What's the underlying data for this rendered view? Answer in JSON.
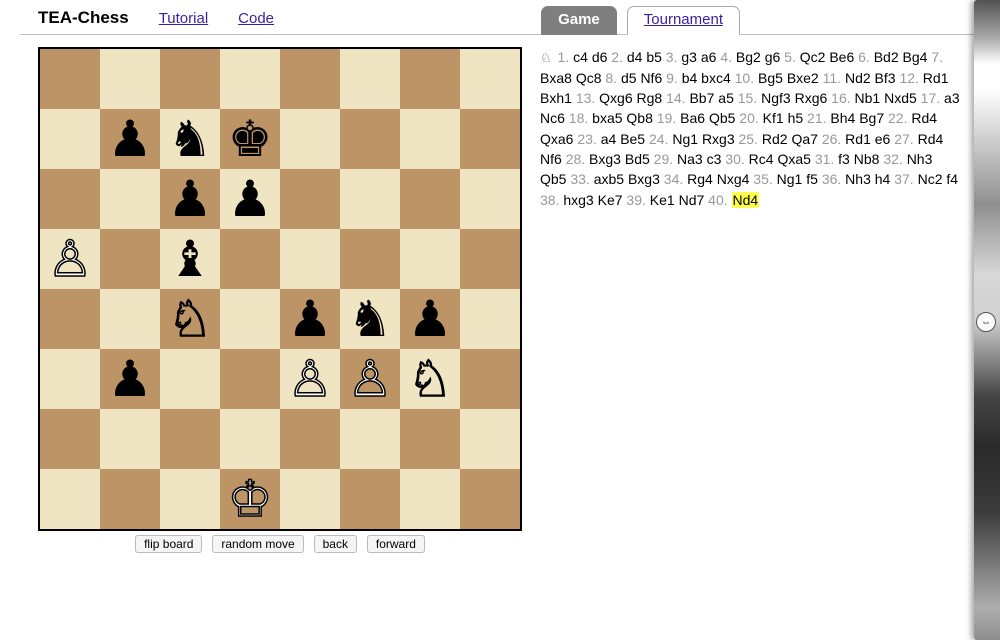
{
  "header": {
    "brand": "TEA-Chess",
    "links": [
      "Tutorial",
      "Code"
    ],
    "tabs": [
      {
        "label": "Game",
        "active": true
      },
      {
        "label": "Tournament",
        "active": false
      }
    ]
  },
  "colors": {
    "light_square": "#efe5c3",
    "dark_square": "#bc9465",
    "highlight_move": "#ffff4d"
  },
  "controls": {
    "flip": "flip board",
    "random": "random move",
    "back": "back",
    "forward": "forward"
  },
  "board": {
    "light_on_a1": true,
    "pieces": [
      {
        "square": "b7",
        "glyph": "♟",
        "color": "black",
        "name": "black-pawn"
      },
      {
        "square": "c7",
        "glyph": "♞",
        "color": "black",
        "name": "black-knight"
      },
      {
        "square": "d7",
        "glyph": "♚",
        "color": "black",
        "name": "black-king"
      },
      {
        "square": "c6",
        "glyph": "♟",
        "color": "black",
        "name": "black-pawn"
      },
      {
        "square": "d6",
        "glyph": "♟",
        "color": "black",
        "name": "black-pawn"
      },
      {
        "square": "a5",
        "glyph": "♙",
        "color": "white",
        "name": "white-pawn"
      },
      {
        "square": "c5",
        "glyph": "♝",
        "color": "black",
        "name": "black-bishop"
      },
      {
        "square": "c4",
        "glyph": "♘",
        "color": "white",
        "name": "white-knight"
      },
      {
        "square": "e4",
        "glyph": "♟",
        "color": "black",
        "name": "black-pawn"
      },
      {
        "square": "f4",
        "glyph": "♞",
        "color": "black",
        "name": "black-knight"
      },
      {
        "square": "g4",
        "glyph": "♟",
        "color": "black",
        "name": "black-pawn"
      },
      {
        "square": "b3",
        "glyph": "♟",
        "color": "black",
        "name": "black-pawn"
      },
      {
        "square": "e3",
        "glyph": "♙",
        "color": "white",
        "name": "white-pawn"
      },
      {
        "square": "f3",
        "glyph": "♙",
        "color": "white",
        "name": "white-pawn"
      },
      {
        "square": "g3",
        "glyph": "♘",
        "color": "white",
        "name": "white-knight"
      },
      {
        "square": "d1",
        "glyph": "♔",
        "color": "white",
        "name": "white-king"
      }
    ]
  },
  "moves": [
    {
      "n": 1,
      "w": "c4",
      "b": "d6"
    },
    {
      "n": 2,
      "w": "d4",
      "b": "b5"
    },
    {
      "n": 3,
      "w": "g3",
      "b": "a6"
    },
    {
      "n": 4,
      "w": "Bg2",
      "b": "g6"
    },
    {
      "n": 5,
      "w": "Qc2",
      "b": "Be6"
    },
    {
      "n": 6,
      "w": "Bd2",
      "b": "Bg4"
    },
    {
      "n": 7,
      "w": "Bxa8",
      "b": "Qc8"
    },
    {
      "n": 8,
      "w": "d5",
      "b": "Nf6"
    },
    {
      "n": 9,
      "w": "b4",
      "b": "bxc4"
    },
    {
      "n": 10,
      "w": "Bg5",
      "b": "Bxe2"
    },
    {
      "n": 11,
      "w": "Nd2",
      "b": "Bf3"
    },
    {
      "n": 12,
      "w": "Rd1",
      "b": "Bxh1"
    },
    {
      "n": 13,
      "w": "Qxg6",
      "b": "Rg8"
    },
    {
      "n": 14,
      "w": "Bb7",
      "b": "a5"
    },
    {
      "n": 15,
      "w": "Ngf3",
      "b": "Rxg6"
    },
    {
      "n": 16,
      "w": "Nb1",
      "b": "Nxd5"
    },
    {
      "n": 17,
      "w": "a3",
      "b": "Nc6"
    },
    {
      "n": 18,
      "w": "bxa5",
      "b": "Qb8"
    },
    {
      "n": 19,
      "w": "Ba6",
      "b": "Qb5"
    },
    {
      "n": 20,
      "w": "Kf1",
      "b": "h5"
    },
    {
      "n": 21,
      "w": "Bh4",
      "b": "Bg7"
    },
    {
      "n": 22,
      "w": "Rd4",
      "b": "Qxa6"
    },
    {
      "n": 23,
      "w": "a4",
      "b": "Be5"
    },
    {
      "n": 24,
      "w": "Ng1",
      "b": "Rxg3"
    },
    {
      "n": 25,
      "w": "Rd2",
      "b": "Qa7"
    },
    {
      "n": 26,
      "w": "Rd1",
      "b": "e6"
    },
    {
      "n": 27,
      "w": "Rd4",
      "b": "Nf6"
    },
    {
      "n": 28,
      "w": "Bxg3",
      "b": "Bd5"
    },
    {
      "n": 29,
      "w": "Na3",
      "b": "c3"
    },
    {
      "n": 30,
      "w": "Rc4",
      "b": "Qxa5"
    },
    {
      "n": 31,
      "w": "f3",
      "b": "Nb8"
    },
    {
      "n": 32,
      "w": "Nh3",
      "b": "Qb5"
    },
    {
      "n": 33,
      "w": "axb5",
      "b": "Bxg3"
    },
    {
      "n": 34,
      "w": "Rg4",
      "b": "Nxg4"
    },
    {
      "n": 35,
      "w": "Ng1",
      "b": "f5"
    },
    {
      "n": 36,
      "w": "Nh3",
      "b": "h4"
    },
    {
      "n": 37,
      "w": "Nc2",
      "b": "f4"
    },
    {
      "n": 38,
      "w": "hxg3",
      "b": "Ke7"
    },
    {
      "n": 39,
      "w": "Ke1",
      "b": "Nd7"
    },
    {
      "n": 40,
      "w": "Nd4",
      "current": "w"
    }
  ],
  "sidebar_handle": {
    "glyph": "⇔"
  }
}
